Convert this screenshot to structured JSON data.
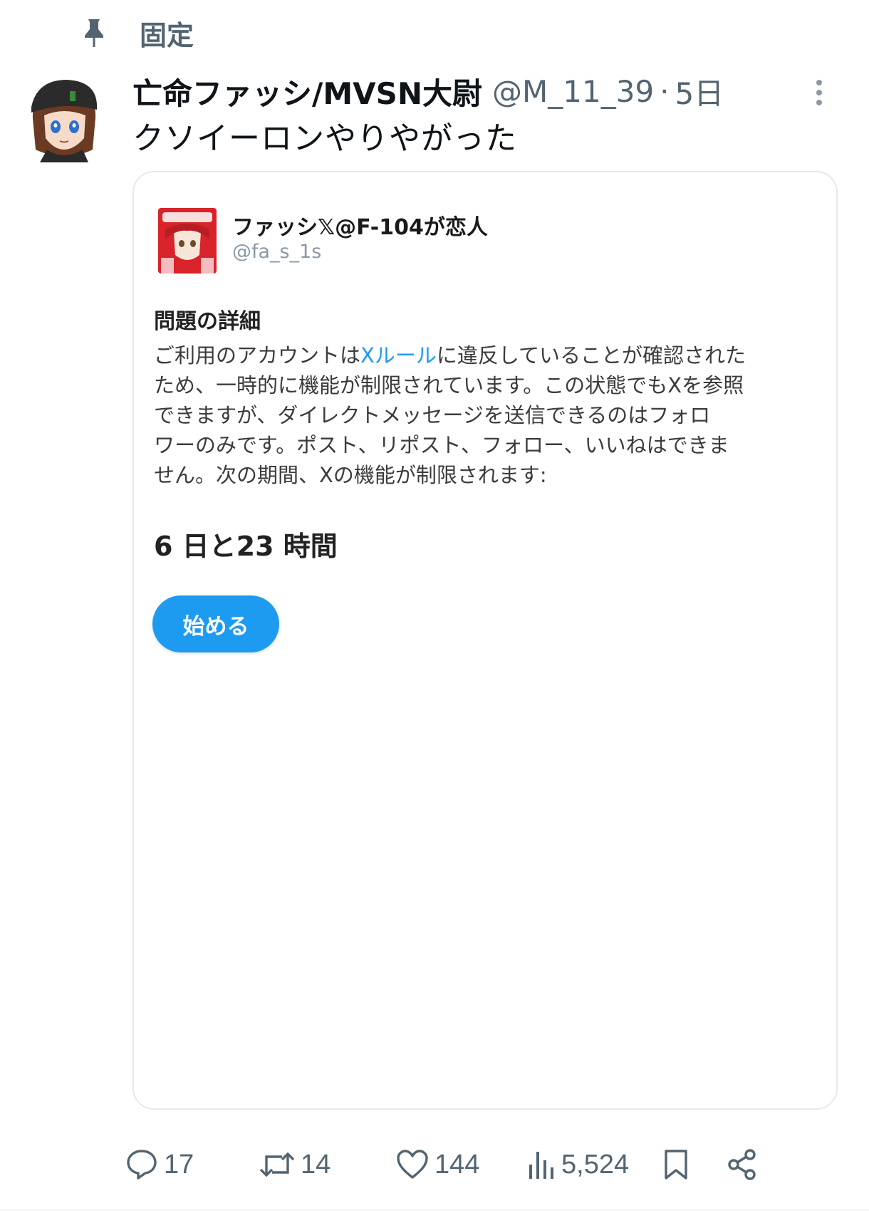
{
  "pinned": {
    "icon": "pin-icon",
    "label": "固定"
  },
  "post": {
    "author": {
      "display_name": "亡命ファッシ/MVSN大尉",
      "handle": "@M_11_39",
      "separator": "·",
      "time": "5日"
    },
    "text": "クソイーロンやりやがった",
    "more_icon": "more-vertical-icon"
  },
  "quoted_card": {
    "author": {
      "display_name": "ファッシ𝕏@F-104が恋人",
      "handle": "@fa_s_1s"
    },
    "heading": "問題の詳細",
    "body": {
      "line1_pre": "ご利用のアカウントは",
      "line1_link": "Xルール",
      "line1_post": "に違反していることが確認された",
      "line2": "ため、一時的に機能が制限されています。この状態でもXを参照",
      "line3": "できますが、ダイレクトメッセージを送信できるのはフォロ",
      "line4": "ワーのみです。ポスト、リポスト、フォロー、いいねはできま",
      "line5": "せん。次の期間、Xの機能が制限されます:"
    },
    "duration": "6 日と23 時間",
    "button_label": "始める"
  },
  "actions": {
    "reply": {
      "icon": "reply-icon",
      "count": "17"
    },
    "repost": {
      "icon": "repost-icon",
      "count": "14"
    },
    "like": {
      "icon": "heart-icon",
      "count": "144"
    },
    "views": {
      "icon": "views-icon",
      "count": "5,524"
    },
    "bookmark": {
      "icon": "bookmark-icon"
    },
    "share": {
      "icon": "share-icon"
    }
  },
  "colors": {
    "text_primary": "#0f1419",
    "text_secondary": "#536471",
    "accent": "#1d9bf0",
    "border": "#e6e9ec"
  }
}
